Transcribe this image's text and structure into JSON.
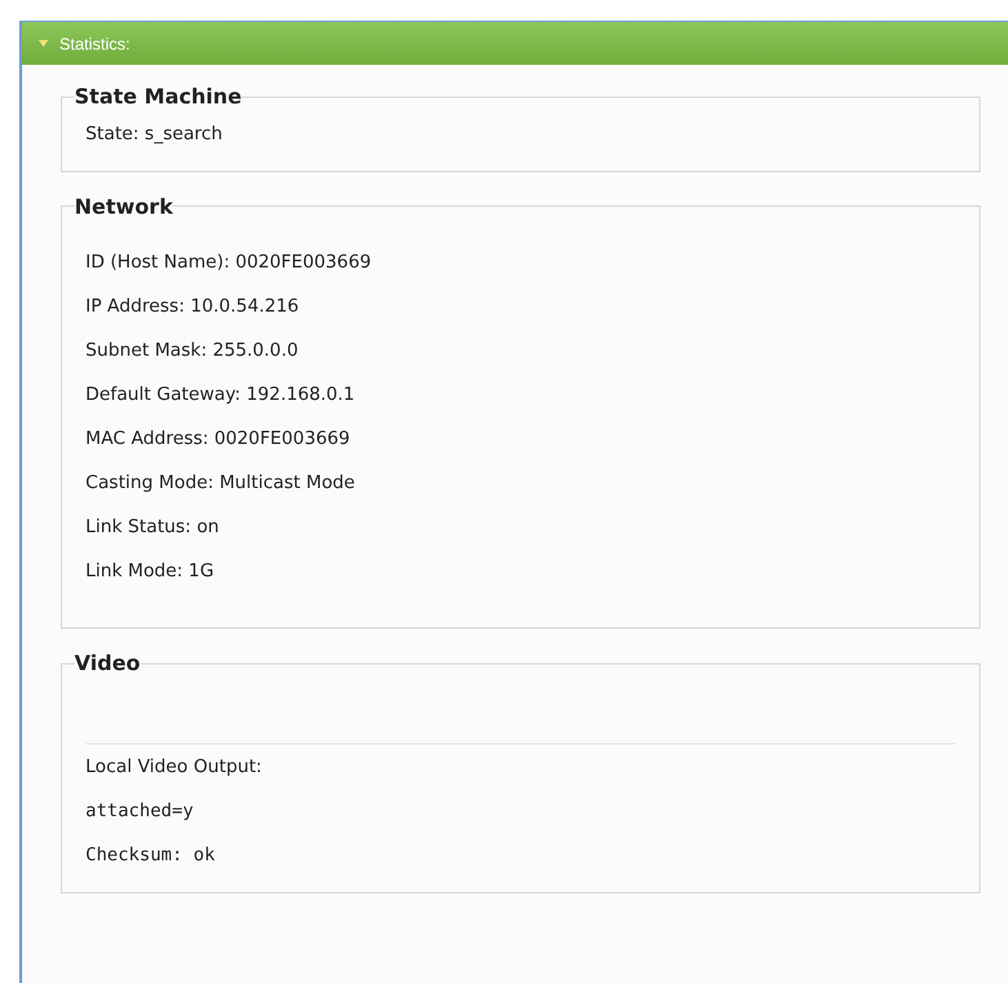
{
  "panel": {
    "title": "Statistics:",
    "expanded": true
  },
  "sections": [
    {
      "title": "State Machine",
      "items": [
        {
          "kind": "text",
          "text": "State: s_search"
        }
      ]
    },
    {
      "title": "Network",
      "items": [
        {
          "kind": "spacer"
        },
        {
          "kind": "text",
          "text": "ID (Host Name): 0020FE003669"
        },
        {
          "kind": "text",
          "text": "IP Address: 10.0.54.216"
        },
        {
          "kind": "text",
          "text": "Subnet Mask: 255.0.0.0"
        },
        {
          "kind": "text",
          "text": "Default Gateway: 192.168.0.1"
        },
        {
          "kind": "text",
          "text": "MAC Address: 0020FE003669"
        },
        {
          "kind": "text",
          "text": "Casting Mode: Multicast Mode"
        },
        {
          "kind": "text",
          "text": "Link Status: on"
        },
        {
          "kind": "text",
          "text": "Link Mode: 1G"
        },
        {
          "kind": "spacer"
        }
      ]
    },
    {
      "title": "Video",
      "items": [
        {
          "kind": "divider"
        },
        {
          "kind": "text",
          "text": "Local Video Output:"
        },
        {
          "kind": "mono",
          "text": "attached=y"
        },
        {
          "kind": "mono",
          "text": "Checksum: ok"
        }
      ]
    }
  ]
}
